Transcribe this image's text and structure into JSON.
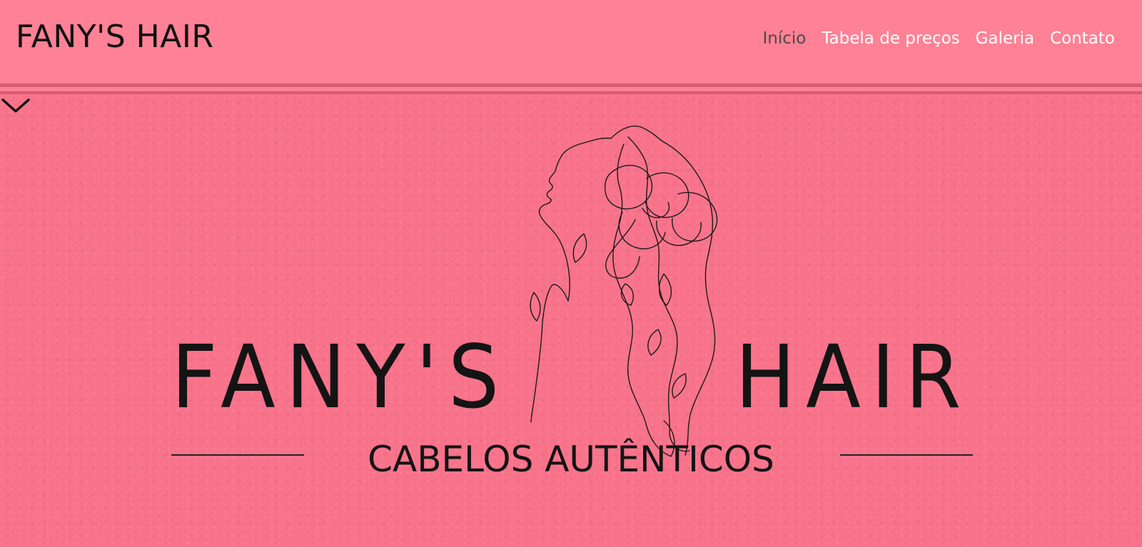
{
  "header": {
    "brand": "FANY'S HAIR",
    "nav": [
      {
        "label": "Início",
        "active": true
      },
      {
        "label": "Tabela de preços",
        "active": false
      },
      {
        "label": "Galeria",
        "active": false
      },
      {
        "label": "Contato",
        "active": false
      }
    ]
  },
  "hero": {
    "logo_left": "FANY'S",
    "logo_right": "HAIR",
    "tagline": "CABELOS AUTÊNTICOS",
    "scroll_icon": "chevron-down-icon"
  },
  "colors": {
    "header_bg": "#ff8195",
    "hero_bg": "#f8728a",
    "divider": "#d75d70",
    "nav_text": "#ffffff",
    "nav_active": "#4b4b4b",
    "ink": "#141414"
  }
}
